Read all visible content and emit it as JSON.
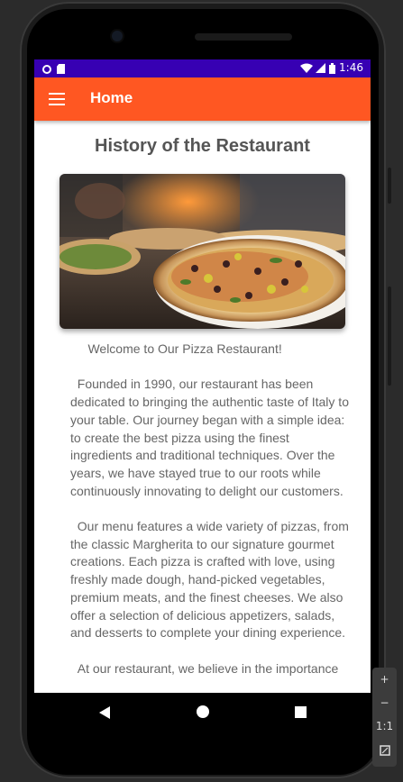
{
  "status_bar": {
    "time": "1:46"
  },
  "app_bar": {
    "title": "Home",
    "menu_icon": "hamburger-menu-icon"
  },
  "page": {
    "title": "History of the Restaurant",
    "image_alt_icon": "pizza-photo",
    "body": "     Welcome to Our Pizza Restaurant!\n\n  Founded in 1990, our restaurant has been dedicated to bringing the authentic taste of Italy to your table. Our journey began with a simple idea: to create the best pizza using the finest ingredients and traditional techniques. Over the years, we have stayed true to our roots while continuously innovating to delight our customers.\n\n  Our menu features a wide variety of pizzas, from the classic Margherita to our signature gourmet creations. Each pizza is crafted with love, using freshly made dough, hand-picked vegetables, premium meats, and the finest cheeses. We also offer a selection of delicious appetizers, salads, and desserts to complete your dining experience.\n\n  At our restaurant, we believe in the importance"
  },
  "emulator_panel": {
    "zoom_in": "+",
    "zoom_out": "−",
    "one_to_one": "1:1"
  },
  "colors": {
    "status_bar": "#3700b3",
    "app_bar": "#ff5722",
    "title_text": "#555555"
  }
}
